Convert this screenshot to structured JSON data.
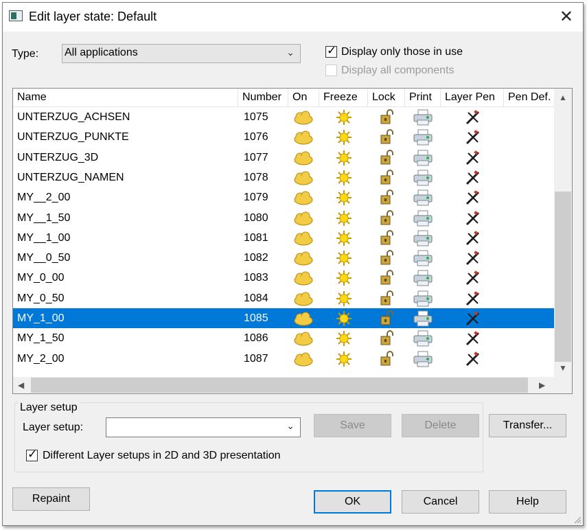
{
  "window": {
    "title": "Edit layer state: Default",
    "close_glyph": "✕"
  },
  "type_field": {
    "label": "Type:",
    "value": "All applications"
  },
  "options": {
    "display_only_in_use": {
      "label": "Display only those in use",
      "checked": true
    },
    "display_all_components": {
      "label": "Display all components",
      "checked": false,
      "enabled": false
    }
  },
  "table": {
    "columns": [
      "Name",
      "Number",
      "On",
      "Freeze",
      "Lock",
      "Print",
      "Layer Pen",
      "Pen Def."
    ],
    "rows": [
      {
        "name": "UNTERZUG_ACHSEN",
        "number": "1075"
      },
      {
        "name": "UNTERZUG_PUNKTE",
        "number": "1076"
      },
      {
        "name": "UNTERZUG_3D",
        "number": "1077"
      },
      {
        "name": "UNTERZUG_NAMEN",
        "number": "1078"
      },
      {
        "name": "MY__2_00",
        "number": "1079"
      },
      {
        "name": "MY__1_50",
        "number": "1080"
      },
      {
        "name": "MY__1_00",
        "number": "1081"
      },
      {
        "name": "MY__0_50",
        "number": "1082"
      },
      {
        "name": "MY_0_00",
        "number": "1083"
      },
      {
        "name": "MY_0_50",
        "number": "1084"
      },
      {
        "name": "MY_1_00",
        "number": "1085"
      },
      {
        "name": "MY_1_50",
        "number": "1086"
      },
      {
        "name": "MY_2_00",
        "number": "1087"
      }
    ],
    "selected_number": "1085",
    "cell_icons": [
      "on-cloud-icon",
      "freeze-sun-icon",
      "lock-open-icon",
      "printer-icon",
      "layer-pen-icon"
    ],
    "scroll_glyphs": {
      "up": "▲",
      "down": "▼",
      "left": "◀",
      "right": "▶"
    }
  },
  "layer_setup": {
    "group_title": "Layer setup",
    "label": "Layer setup:",
    "value": "",
    "save_label": "Save",
    "delete_label": "Delete",
    "transfer_label": "Transfer...",
    "different_setups": {
      "label": "Different Layer setups in 2D and 3D presentation",
      "checked": true
    }
  },
  "buttons": {
    "repaint": "Repaint",
    "ok": "OK",
    "cancel": "Cancel",
    "help": "Help"
  },
  "colors": {
    "selection": "#0078d7",
    "dialog_bg": "#f0f0f0",
    "cloud": "#f1c232",
    "sun": "#e8c000"
  }
}
